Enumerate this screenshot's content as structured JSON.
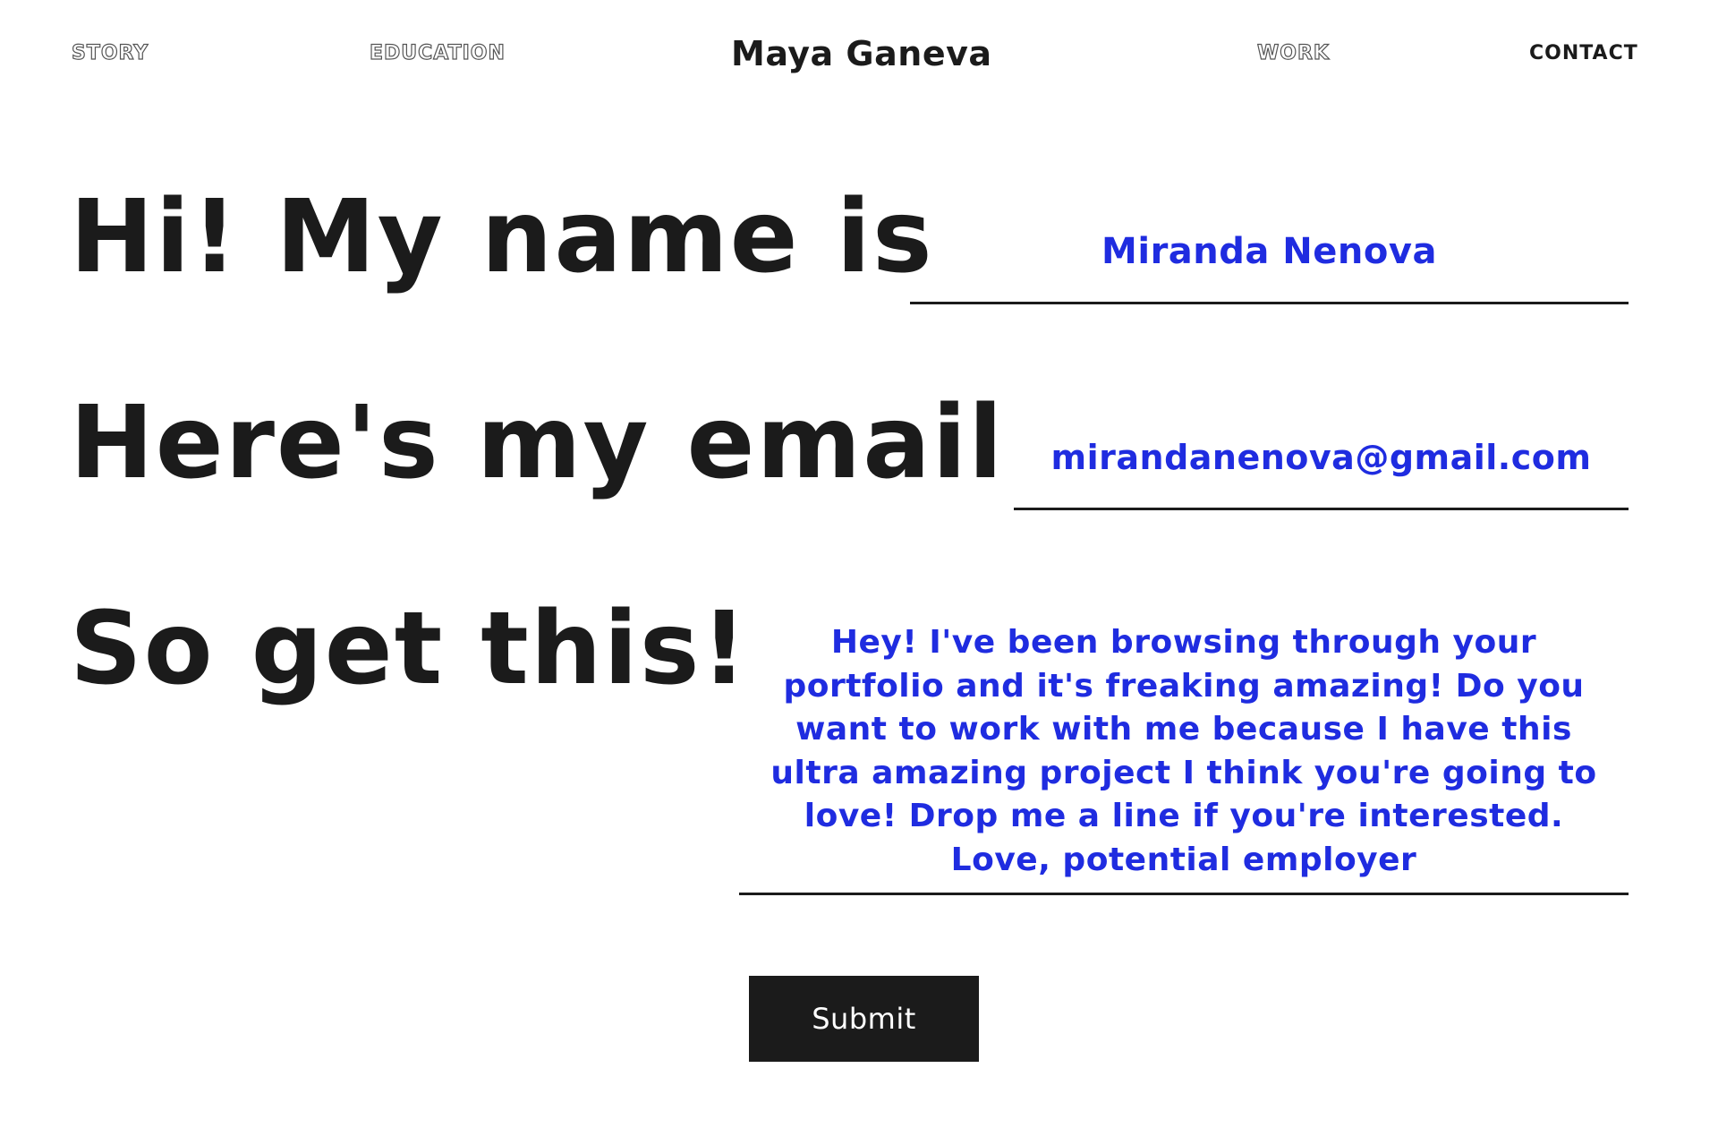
{
  "nav": {
    "story": "STORY",
    "education": "EDUCATION",
    "title": "Maya Ganeva",
    "work": "WORK",
    "contact": "CONTACT"
  },
  "form": {
    "name_prompt": "Hi! My name is",
    "name_value": "Miranda Nenova",
    "email_prompt": "Here's my email",
    "email_value": "mirandanenova@gmail.com",
    "message_prompt": "So get this!",
    "message_value": "Hey! I've been browsing through your\nportfolio and it's freaking amazing! Do you\nwant to work with me because I have this\nultra amazing project I think you're going to\nlove! Drop me a line if you're interested.\nLove, potential employer",
    "submit_label": "Submit"
  },
  "colors": {
    "text": "#1b1b1b",
    "accent": "#1f2ce0",
    "background": "#ffffff"
  }
}
